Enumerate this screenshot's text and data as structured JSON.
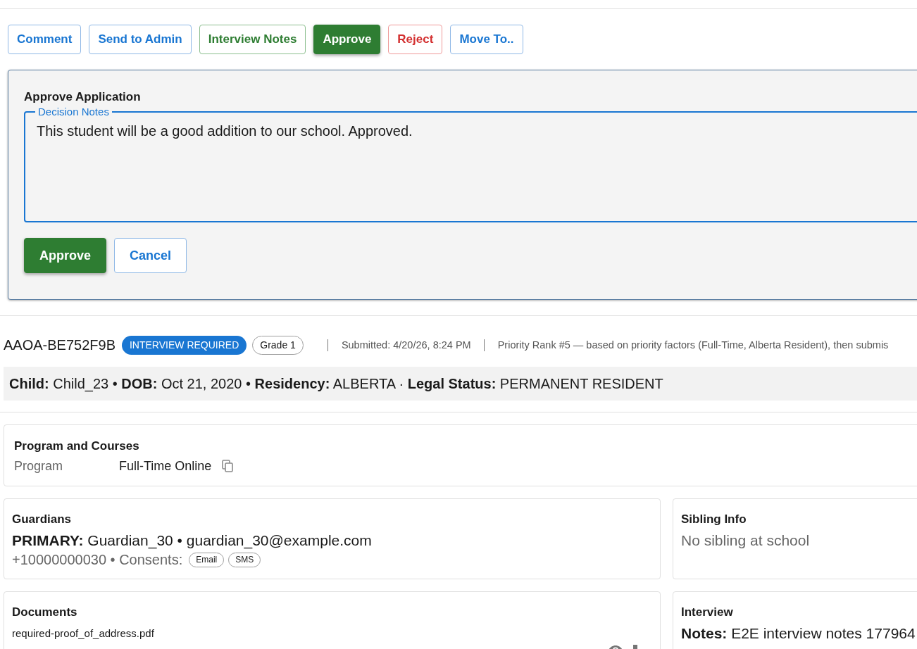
{
  "action_buttons": [
    {
      "label": "Comment",
      "kind": "outline"
    },
    {
      "label": "Send to Admin",
      "kind": "outline"
    },
    {
      "label": "Interview Notes",
      "kind": "notes"
    },
    {
      "label": "Approve",
      "kind": "approve"
    },
    {
      "label": "Reject",
      "kind": "reject"
    },
    {
      "label": "Move To..",
      "kind": "outline"
    }
  ],
  "approve_dialog": {
    "title": "Approve Application",
    "notes_field": {
      "label": "Decision Notes",
      "value": "This student will be a good addition to our school. Approved.",
      "focused": true
    },
    "buttons": [
      {
        "label": "Approve",
        "kind": "approve"
      },
      {
        "label": "Cancel",
        "kind": "outline"
      }
    ]
  },
  "application": {
    "id": "AAOA-BE752F9B",
    "status": "INTERVIEW REQUIRED",
    "grade": "Grade 1",
    "submitted": "Submitted: 4/20/26, 8:24 PM",
    "priority": "Priority Rank #5 — based on priority factors (Full-Time, Alberta Resident), then submis"
  },
  "child_summary": "**Child:** Child_23 • **DOB:** Oct 21, 2020 • **Residency:** ALBERTA · **Legal Status:** PERMANENT RESIDENT",
  "program_card": {
    "title": "Program and Courses",
    "rows": [
      {
        "label": "Program",
        "value": "Full-Time Online"
      }
    ]
  },
  "guardians_card": {
    "title": "Guardians",
    "primary": "**PRIMARY:** Guardian_30 • guardian_30@example.com",
    "contact": "+10000000030 • Consents:",
    "consents": [
      "Email",
      "SMS"
    ]
  },
  "sibling_card": {
    "title": "Sibling Info",
    "text": "No sibling at school"
  },
  "documents_card": {
    "title": "Documents",
    "files": [
      {
        "name": "required-proof_of_address.pdf"
      }
    ]
  },
  "interview_card": {
    "title": "Interview",
    "notes": "**Notes:** E2E interview notes 177964"
  }
}
